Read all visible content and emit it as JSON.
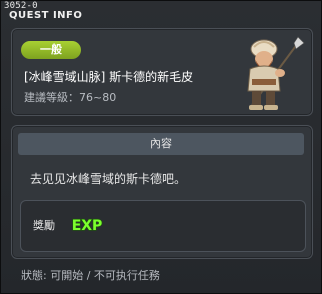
{
  "window": {
    "quest_id": "3052-0",
    "title": "QUEST INFO"
  },
  "quest": {
    "category_badge": "一般",
    "title": "[冰峰雪域山脉] 斯卡德的新毛皮",
    "level": "建議等級：76~80"
  },
  "content": {
    "header": "內容",
    "description": "去见见冰峰雪域的斯卡德吧。"
  },
  "reward": {
    "label": "獎勵",
    "exp_icon_text": "EXP"
  },
  "status": {
    "text": "狀態: 可開始 / 不可执行任務"
  },
  "colors": {
    "badge_green": "#8dba26",
    "exp_green": "#7cff2e"
  },
  "icons": {
    "npc": "hunter-npc-portrait",
    "exp": "exp-icon"
  }
}
